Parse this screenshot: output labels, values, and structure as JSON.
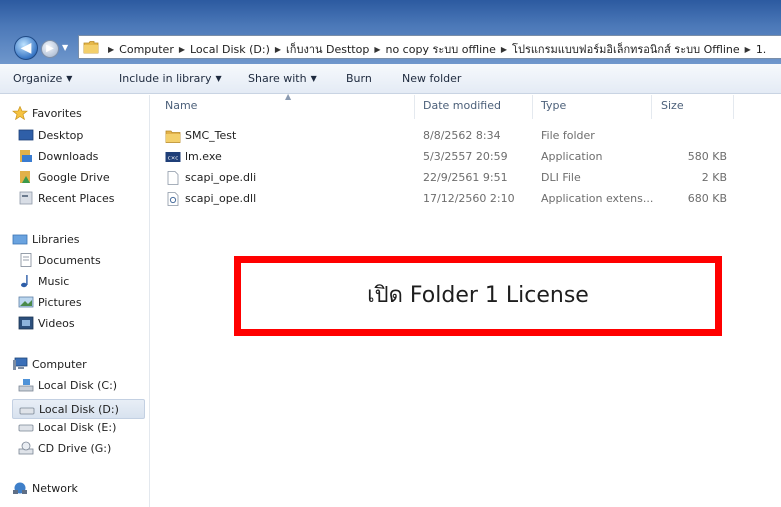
{
  "address": {
    "crumbs": [
      "Computer",
      "Local Disk (D:)",
      "เก็บงาน Desttop",
      "no copy ระบบ offline",
      "โปรแกรมแบบฟอร์มอิเล็กทรอนิกส์ ระบบ Offline",
      "1."
    ]
  },
  "toolbar": {
    "organize": "Organize",
    "include": "Include in library",
    "share": "Share with",
    "burn": "Burn",
    "new_folder": "New folder"
  },
  "nav": {
    "favorites": "Favorites",
    "desktop": "Desktop",
    "downloads": "Downloads",
    "google_drive": "Google Drive",
    "recent": "Recent Places",
    "libraries": "Libraries",
    "documents": "Documents",
    "music": "Music",
    "pictures": "Pictures",
    "videos": "Videos",
    "computer": "Computer",
    "disk_c": "Local Disk (C:)",
    "disk_d": "Local Disk (D:)",
    "disk_e": "Local Disk (E:)",
    "cd": "CD Drive (G:)",
    "network": "Network"
  },
  "columns": {
    "name": "Name",
    "date": "Date modified",
    "type": "Type",
    "size": "Size"
  },
  "files": [
    {
      "name": "SMC_Test",
      "date": "8/8/2562 8:34",
      "type": "File folder",
      "size": ""
    },
    {
      "name": "lm.exe",
      "date": "5/3/2557 20:59",
      "type": "Application",
      "size": "580 KB"
    },
    {
      "name": "scapi_ope.dli",
      "date": "22/9/2561 9:51",
      "type": "DLI File",
      "size": "2 KB"
    },
    {
      "name": "scapi_ope.dll",
      "date": "17/12/2560 2:10",
      "type": "Application extens...",
      "size": "680 KB"
    }
  ],
  "annotation": {
    "text": "เปิด Folder 1 License",
    "color": "#ff0000"
  },
  "icons": {
    "back": "back-arrow-icon",
    "forward": "forward-arrow-icon",
    "folder": "folder-icon",
    "star": "star-icon"
  }
}
